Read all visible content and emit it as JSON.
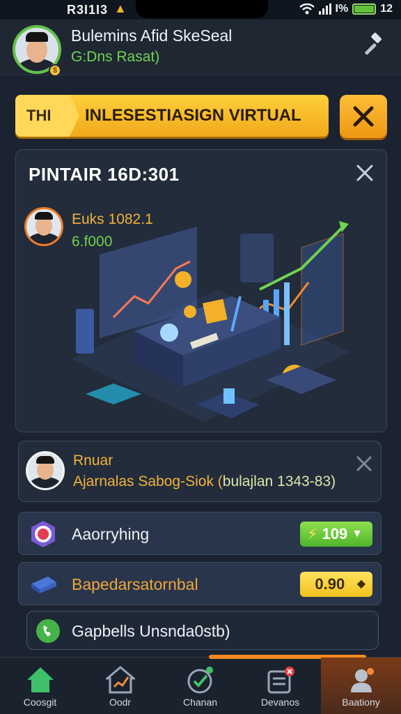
{
  "status_bar": {
    "time": "R3I1I3",
    "right_text": "I%",
    "right_num": "12",
    "warning_icon": "warning-icon",
    "colors": {
      "battery": "#63c23b"
    }
  },
  "header": {
    "name": "Bulemins Afid SkeSeal",
    "subtitle": "G:Dns Rasat)",
    "coin_badge": "$"
  },
  "banner": {
    "tag": "THI",
    "title": "INLESESTIASIGN VIRTUAL"
  },
  "card": {
    "title": "PINTAIR 16D:301",
    "user_name": "Euks 1082.1",
    "user_value": "6.f000"
  },
  "notification": {
    "title": "Rnuar",
    "body_main": "Ajarnalas Sabog-Siok (",
    "body_paren": "bulajlan 1343-83)"
  },
  "list": [
    {
      "label": "Aaorryhing",
      "pill": "109",
      "pill_color": "#4fb52c"
    },
    {
      "label": "Bapedarsatornbal",
      "pill": "0.90",
      "pill_color": "#f3c21f"
    }
  ],
  "row3": {
    "label": "Gapbells Unsnda0stb)"
  },
  "nav": [
    {
      "label": "Coosgit",
      "icon": "home-icon"
    },
    {
      "label": "Oodr",
      "icon": "house-chart-icon"
    },
    {
      "label": "Chanan",
      "icon": "globe-icon"
    },
    {
      "label": "Devanos",
      "icon": "list-badge-icon",
      "badge": "x"
    },
    {
      "label": "Baationy",
      "icon": "user-icon"
    }
  ]
}
